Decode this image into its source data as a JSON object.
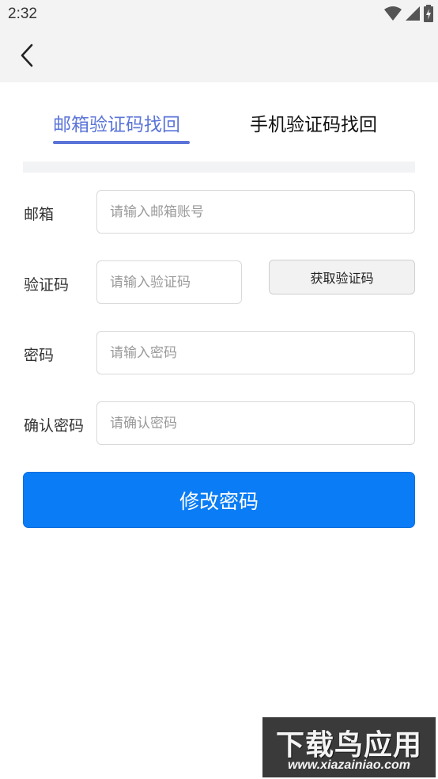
{
  "status_bar": {
    "time": "2:32",
    "icons": [
      "wifi-icon",
      "signal-icon",
      "battery-charging-icon"
    ]
  },
  "app_bar": {
    "back_icon": "chevron-left-icon"
  },
  "tabs": [
    {
      "label": "邮箱验证码找回",
      "active": true
    },
    {
      "label": "手机验证码找回",
      "active": false
    }
  ],
  "form": {
    "email": {
      "label": "邮箱",
      "placeholder": "请输入邮箱账号",
      "value": ""
    },
    "code": {
      "label": "验证码",
      "placeholder": "请输入验证码",
      "value": "",
      "button_label": "获取验证码"
    },
    "password": {
      "label": "密码",
      "placeholder": "请输入密码",
      "value": ""
    },
    "confirm": {
      "label": "确认密码",
      "placeholder": "请确认密码",
      "value": ""
    },
    "submit_label": "修改密码"
  },
  "watermark": {
    "title": "下载鸟应用",
    "url": "www.xiazainiao.com"
  },
  "colors": {
    "accent": "#5b74d8",
    "primary_button": "#0a7cf5",
    "status_bar_bg": "#f3f3f3"
  }
}
